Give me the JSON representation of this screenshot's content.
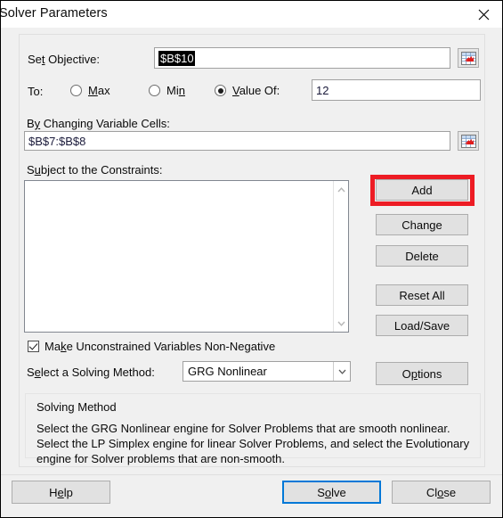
{
  "window": {
    "title": "Solver Parameters",
    "close_icon": "close-x-icon"
  },
  "objective": {
    "label": "Set Objective:",
    "value": "$B$10",
    "picker_icon": "range-select-icon"
  },
  "to_row": {
    "label": "To:",
    "options": [
      {
        "label": "Max",
        "selected": false
      },
      {
        "label": "Min",
        "selected": false
      },
      {
        "label": "Value Of:",
        "selected": true
      }
    ],
    "value_of": "12"
  },
  "variable_cells": {
    "label": "By Changing Variable Cells:",
    "value": "$B$7:$B$8",
    "picker_icon": "range-select-icon"
  },
  "constraints": {
    "label": "Subject to the Constraints:",
    "items": [],
    "scroll_up_icon": "chevron-up-icon",
    "scroll_down_icon": "chevron-down-icon"
  },
  "constraint_buttons": [
    {
      "label": "Add",
      "name": "add-button",
      "highlighted": true
    },
    {
      "label": "Change",
      "name": "change-button",
      "highlighted": false
    },
    {
      "label": "Delete",
      "name": "delete-button",
      "highlighted": false
    },
    {
      "label": "Reset All",
      "name": "reset-all-button",
      "highlighted": false
    },
    {
      "label": "Load/Save",
      "name": "load-save-button",
      "highlighted": false
    }
  ],
  "non_negative": {
    "label": "Make Unconstrained Variables Non-Negative",
    "checked": true
  },
  "solving_method": {
    "label": "Select a Solving Method:",
    "selected": "GRG Nonlinear",
    "dropdown_icon": "chevron-down-icon",
    "options_label": "Options"
  },
  "description": {
    "title": "Solving Method",
    "body": "Select the GRG Nonlinear engine for Solver Problems that are smooth nonlinear. Select the LP Simplex engine for linear Solver Problems, and select the Evolutionary engine for Solver problems that are non-smooth."
  },
  "footer": {
    "help": "Help",
    "solve": "Solve",
    "close": "Close"
  },
  "colors": {
    "highlight_red": "#ed1c24",
    "focus_blue": "#0078d7",
    "dialog_bg": "#f0f0f0",
    "selection_bg": "#000000"
  }
}
